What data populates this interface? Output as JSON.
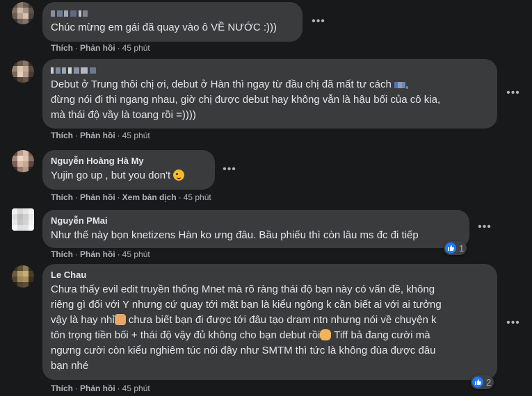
{
  "comments": [
    {
      "author": "",
      "author_blurred": true,
      "text_lines": [
        "Chúc mừng em gái đã quay vào ô VỀ NƯỚC :)))"
      ],
      "like_label": "Thích",
      "reply_label": "Phản hồi",
      "time": "45 phút"
    },
    {
      "author": "",
      "author_blurred": true,
      "text_lines": [
        "Debut ở Trung thôi chị ơi, debut ở Hàn thì ngay từ đầu chị đã mất tư cách",
        "đừng nói đi thi ngang nhau, giờ chị được debut hay không vẫn là hậu bối của cô kia,",
        "mà thái độ vầy là toang rồi =))))"
      ],
      "like_label": "Thích",
      "reply_label": "Phản hồi",
      "time": "45 phút"
    },
    {
      "author": "Nguyễn Hoàng Hà My",
      "text_lines": [
        "Yujin go up , but you don't"
      ],
      "emoji": "winking-face-icon",
      "like_label": "Thích",
      "reply_label": "Phản hồi",
      "translate_label": "Xem bản dịch",
      "time": "45 phút"
    },
    {
      "author": "Nguyễn PMai",
      "text_lines": [
        "Như thế này bọn knetizens Hàn ko ưng đâu. Bầu phiếu thì còn lâu ms đc đi tiếp"
      ],
      "like_label": "Thích",
      "reply_label": "Phản hồi",
      "time": "45 phút",
      "reactions": "1"
    },
    {
      "author": "Le Chau",
      "text_lines": [
        "Chưa thấy evil edit truyền thống Mnet mà rõ ràng thái độ bạn này có vấn đề, không",
        "riêng gì đối với Y nhưng cứ quay tới mặt bạn là kiểu ngông k cần biết ai với ai tưởng",
        "vậy là hay nhỉ",
        "tôn trọng tiền bối + thái độ vậy đủ không cho bạn debut rồi",
        "ngưng cười còn kiểu nghiêm túc nói đây như SMTM thì tức là không đùa được đâu",
        "bạn nhé"
      ],
      "line3_rest": "chưa biết bạn đi được tới đâu tạo dram ntn nhưng nói về chuyện k",
      "line4_rest": "Tiff bả đang cười mà",
      "like_label": "Thích",
      "reply_label": "Phản hồi",
      "time": "45 phút",
      "reactions": "2"
    }
  ],
  "colors": {
    "background": "#18191a",
    "bubble": "#3a3b3c",
    "secondary_text": "#b0b3b8",
    "primary_text": "#e4e6eb",
    "like_blue": "#2078f4"
  },
  "icons": [
    "more-options-icon",
    "like-reaction-icon",
    "winking-face-icon",
    "person-gesturing-icon",
    "hand-ok-icon"
  ]
}
